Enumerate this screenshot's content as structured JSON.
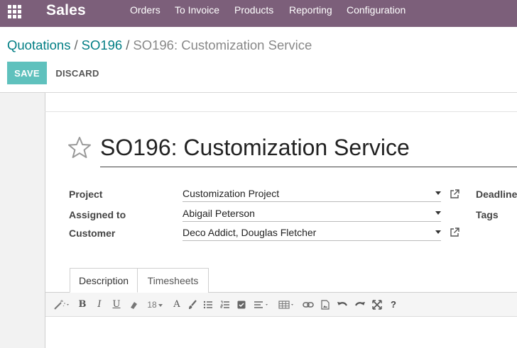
{
  "navbar": {
    "app_name": "Sales",
    "menu": [
      "Orders",
      "To Invoice",
      "Products",
      "Reporting",
      "Configuration"
    ],
    "background_color": "#7c5f7a"
  },
  "breadcrumb": {
    "items": [
      "Quotations",
      "SO196"
    ],
    "separator": "/",
    "current": "SO196: Customization Service"
  },
  "actions": {
    "save_label": "SAVE",
    "discard_label": "DISCARD",
    "save_color": "#5fc1bd"
  },
  "form": {
    "title": "SO196: Customization Service",
    "favorite_icon": "star-outline-icon",
    "fields": [
      {
        "label": "Project",
        "value": "Customization Project",
        "has_external_link": true
      },
      {
        "label": "Assigned to",
        "value": "Abigail Peterson",
        "has_external_link": false
      },
      {
        "label": "Customer",
        "value": "Deco Addict, Douglas Fletcher",
        "has_external_link": true
      }
    ],
    "right_fields": [
      {
        "label": "Deadline"
      },
      {
        "label": "Tags"
      }
    ]
  },
  "tabs": [
    {
      "label": "Description",
      "active": true
    },
    {
      "label": "Timesheets",
      "active": false
    }
  ],
  "editor_toolbar": {
    "font_size": "18",
    "buttons": [
      "magic-wand-icon",
      "bold-icon",
      "italic-icon",
      "underline-icon",
      "eraser-icon",
      "font-size-select",
      "font-color-icon",
      "brush-icon",
      "unordered-list-icon",
      "ordered-list-icon",
      "checklist-icon",
      "align-icon",
      "table-icon",
      "link-icon",
      "image-icon",
      "undo-icon",
      "redo-icon",
      "fullscreen-icon",
      "help-icon"
    ],
    "bold_label": "B",
    "italic_label": "I",
    "underline_label": "U",
    "font_color_label": "A",
    "help_label": "?"
  }
}
